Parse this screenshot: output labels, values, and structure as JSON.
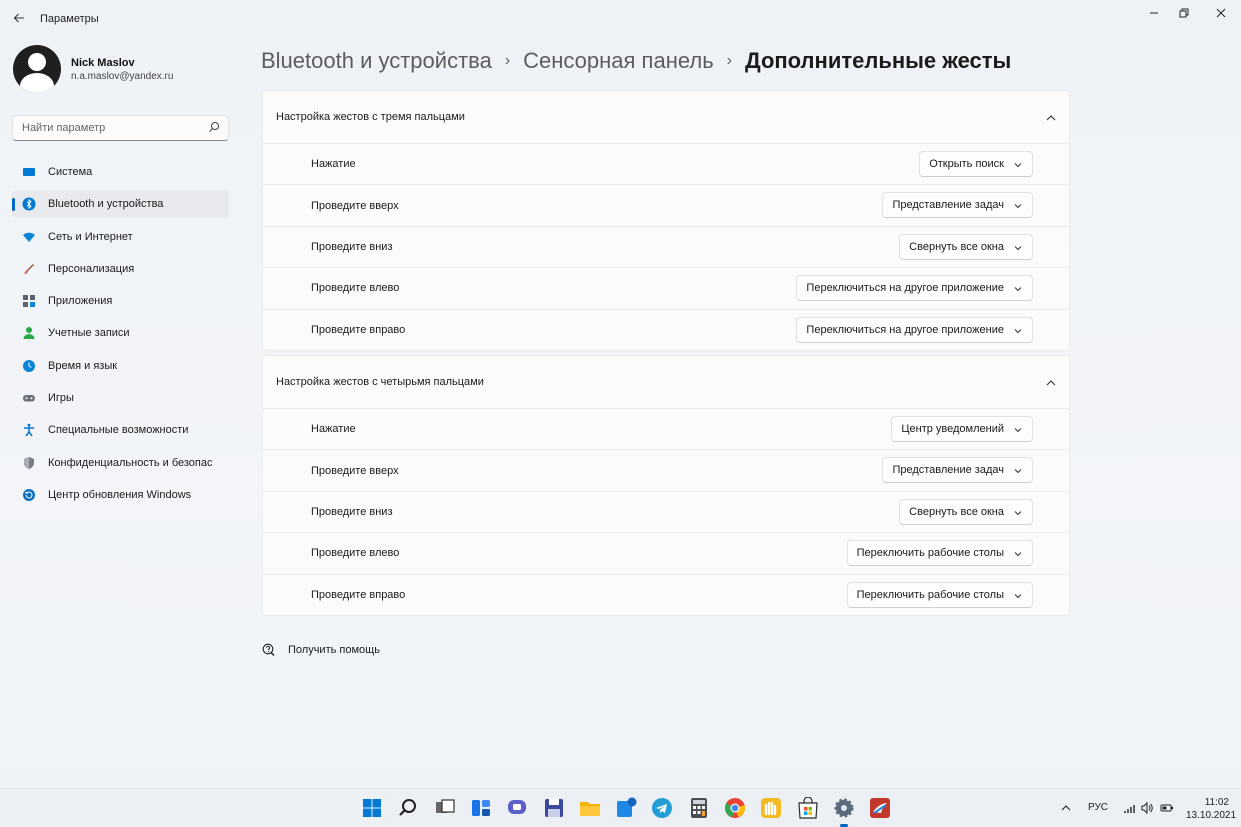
{
  "window": {
    "title": "Параметры",
    "back_icon": "arrow-left-icon",
    "controls": {
      "minimize": "—",
      "maximize": "❐",
      "close": "✕"
    }
  },
  "profile": {
    "name": "Nick Maslov",
    "email": "n.a.maslov@yandex.ru"
  },
  "search": {
    "placeholder": "Найти параметр"
  },
  "sidebar": {
    "items": [
      {
        "label": "Система",
        "icon": "monitor-icon",
        "color": "#0078d4",
        "active": false
      },
      {
        "label": "Bluetooth и устройства",
        "icon": "bluetooth-icon",
        "color": "#0078d4",
        "active": true
      },
      {
        "label": "Сеть и Интернет",
        "icon": "wifi-icon",
        "color": "#0a84d6",
        "active": false
      },
      {
        "label": "Персонализация",
        "icon": "brush-icon",
        "color": "#e0604e",
        "active": false
      },
      {
        "label": "Приложения",
        "icon": "apps-icon",
        "color": "#5b6270",
        "active": false
      },
      {
        "label": "Учетные записи",
        "icon": "person-icon",
        "color": "#28a745",
        "active": false
      },
      {
        "label": "Время и язык",
        "icon": "globe-clock-icon",
        "color": "#0a84d6",
        "active": false
      },
      {
        "label": "Игры",
        "icon": "gamepad-icon",
        "color": "#6c717a",
        "active": false
      },
      {
        "label": "Специальные возможности",
        "icon": "accessibility-icon",
        "color": "#0a6fc2",
        "active": false
      },
      {
        "label": "Конфиденциальность и безопас",
        "icon": "shield-icon",
        "color": "#7a7f87",
        "active": false
      },
      {
        "label": "Центр обновления Windows",
        "icon": "update-icon",
        "color": "#0a6fc2",
        "active": false
      }
    ]
  },
  "breadcrumb": {
    "items": [
      "Bluetooth и устройства",
      "Сенсорная панель"
    ],
    "current": "Дополнительные жесты",
    "separator": "›"
  },
  "sections": [
    {
      "title": "Настройка жестов с тремя пальцами",
      "rows": [
        {
          "label": "Нажатие",
          "value": "Открыть поиск"
        },
        {
          "label": "Проведите вверх",
          "value": "Представление задач"
        },
        {
          "label": "Проведите вниз",
          "value": "Свернуть все окна"
        },
        {
          "label": "Проведите влево",
          "value": "Переключиться на другое приложение"
        },
        {
          "label": "Проведите вправо",
          "value": "Переключиться на другое приложение"
        }
      ]
    },
    {
      "title": "Настройка жестов с четырьмя пальцами",
      "rows": [
        {
          "label": "Нажатие",
          "value": "Центр уведомлений"
        },
        {
          "label": "Проведите вверх",
          "value": "Представление задач"
        },
        {
          "label": "Проведите вниз",
          "value": "Свернуть все окна"
        },
        {
          "label": "Проведите влево",
          "value": "Переключить рабочие столы"
        },
        {
          "label": "Проведите вправо",
          "value": "Переключить рабочие столы"
        }
      ]
    }
  ],
  "help": {
    "label": "Получить помощь",
    "icon": "help-chat-icon"
  },
  "taskbar": {
    "apps": [
      {
        "name": "start-icon",
        "color": "#0078d4"
      },
      {
        "name": "search-icon",
        "color": "#222222"
      },
      {
        "name": "task-view-icon",
        "color": "#333333"
      },
      {
        "name": "widgets-icon",
        "color": "#1a73e8"
      },
      {
        "name": "chat-icon",
        "color": "#5b5fc7"
      },
      {
        "name": "save-app-icon",
        "color": "#3b4a9c"
      },
      {
        "name": "file-explorer-icon",
        "color": "#f2b400"
      },
      {
        "name": "store-blue-icon",
        "color": "#1e88e5"
      },
      {
        "name": "telegram-icon",
        "color": "#229ed9"
      },
      {
        "name": "calculator-icon",
        "color": "#4a4f56"
      },
      {
        "name": "chrome-icon",
        "color": "#34a853"
      },
      {
        "name": "hand-app-icon",
        "color": "#f5b921"
      },
      {
        "name": "microsoft-store-icon",
        "color": "#2b2b2b"
      },
      {
        "name": "settings-icon",
        "color": "#5a6a7a"
      },
      {
        "name": "screenshot-app-icon",
        "color": "#c0392b"
      }
    ],
    "tray": {
      "lang": "РУС",
      "time": "11:02",
      "date": "13.10.2021"
    }
  },
  "colors": {
    "accent": "#0067c0",
    "card": "#fbfbfc",
    "border": "#ebebeb"
  }
}
